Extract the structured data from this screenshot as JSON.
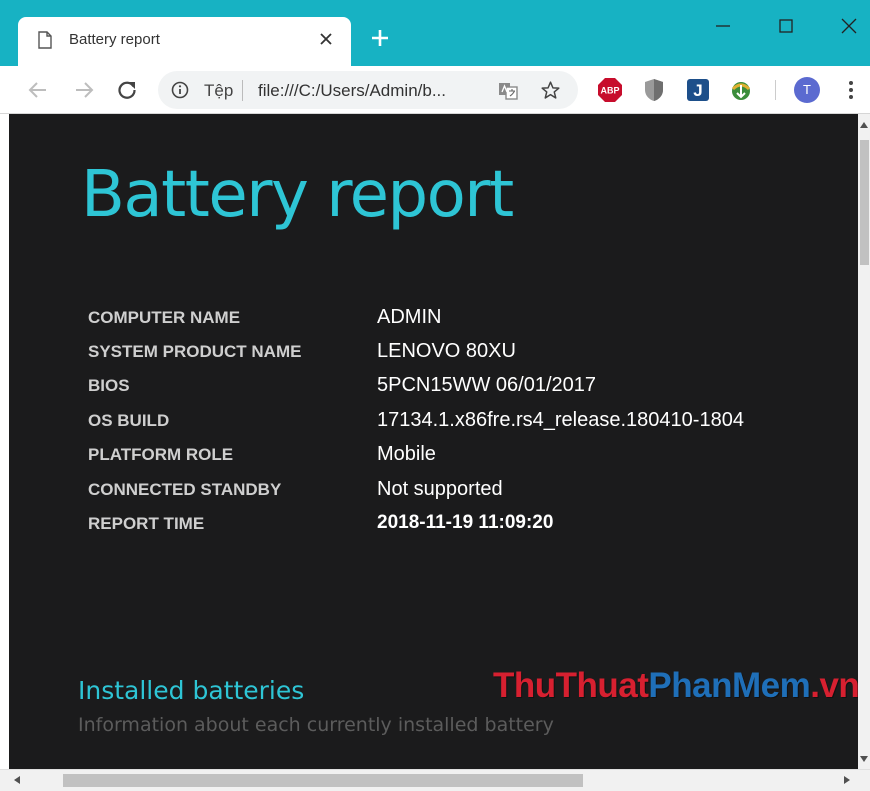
{
  "browser": {
    "tab": {
      "title": "Battery report"
    },
    "omnibox": {
      "scheme_label": "Tệp",
      "url": "file:///C:/Users/Admin/b..."
    },
    "profile": {
      "initial": "T"
    },
    "extensions": [
      "adblock-plus-icon",
      "shield-extension-icon",
      "j-extension-icon",
      "idm-extension-icon"
    ],
    "colors": {
      "titlebar": "#17b2c3",
      "page_background": "#1b1b1c",
      "accent": "#2ec5d5"
    }
  },
  "report": {
    "title": "Battery report",
    "system_info": [
      {
        "label": "COMPUTER NAME",
        "value": "ADMIN"
      },
      {
        "label": "SYSTEM PRODUCT NAME",
        "value": "LENOVO 80XU"
      },
      {
        "label": "BIOS",
        "value": "5PCN15WW 06/01/2017"
      },
      {
        "label": "OS BUILD",
        "value": "17134.1.x86fre.rs4_release.180410-1804"
      },
      {
        "label": "PLATFORM ROLE",
        "value": "Mobile"
      },
      {
        "label": "CONNECTED STANDBY",
        "value": "Not supported"
      },
      {
        "label": "REPORT TIME",
        "value": "2018-11-19  11:09:20"
      }
    ],
    "installed_batteries": {
      "title": "Installed batteries",
      "description": "Information about each currently installed battery"
    }
  },
  "watermark": {
    "part1": "ThuThuat",
    "part2": "PhanMem",
    "part3": ".vn"
  }
}
